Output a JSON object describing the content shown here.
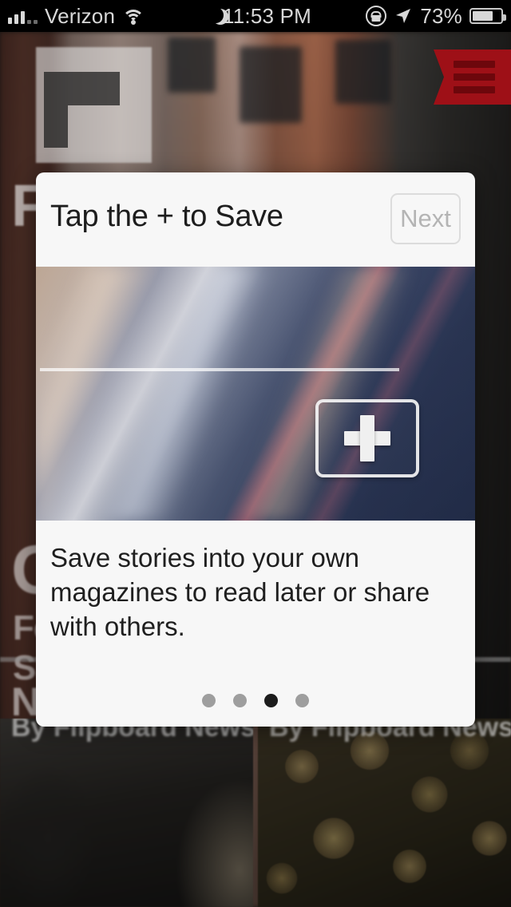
{
  "statusbar": {
    "carrier": "Verizon",
    "wifi_icon": "wifi-icon",
    "dnd_icon": "moon-icon",
    "time": "11:53 PM",
    "rotation_lock_icon": "rotation-lock-icon",
    "location_icon": "location-arrow-icon",
    "battery_percent": "73%",
    "battery_icon": "battery-icon"
  },
  "background": {
    "app_logo_icon": "flipboard-f-logo-icon",
    "menu_icon": "hamburger-menu-icon",
    "menu_ribbon_color": "#9e1017",
    "headline_partial": "Fl",
    "article_headline_partial": "C",
    "article_line1_partial": "Fe",
    "article_line2_partial": "Sa",
    "lower_headline_partial": "N",
    "tiles": [
      {
        "byline": "By Flipboard Newsdesk",
        "image": "people-ceremony-photo"
      },
      {
        "byline": "By Flipboard Newsdesk",
        "image": "coins-pile-photo"
      }
    ]
  },
  "modal": {
    "title": "Tap the + to Save",
    "next_label": "Next",
    "hero_image": "blurred-light-streaks-photo",
    "save_button_icon": "plus-icon",
    "description": "Save stories into your own magazines to read later or share with others.",
    "pager": {
      "total": 4,
      "active_index": 2
    }
  }
}
